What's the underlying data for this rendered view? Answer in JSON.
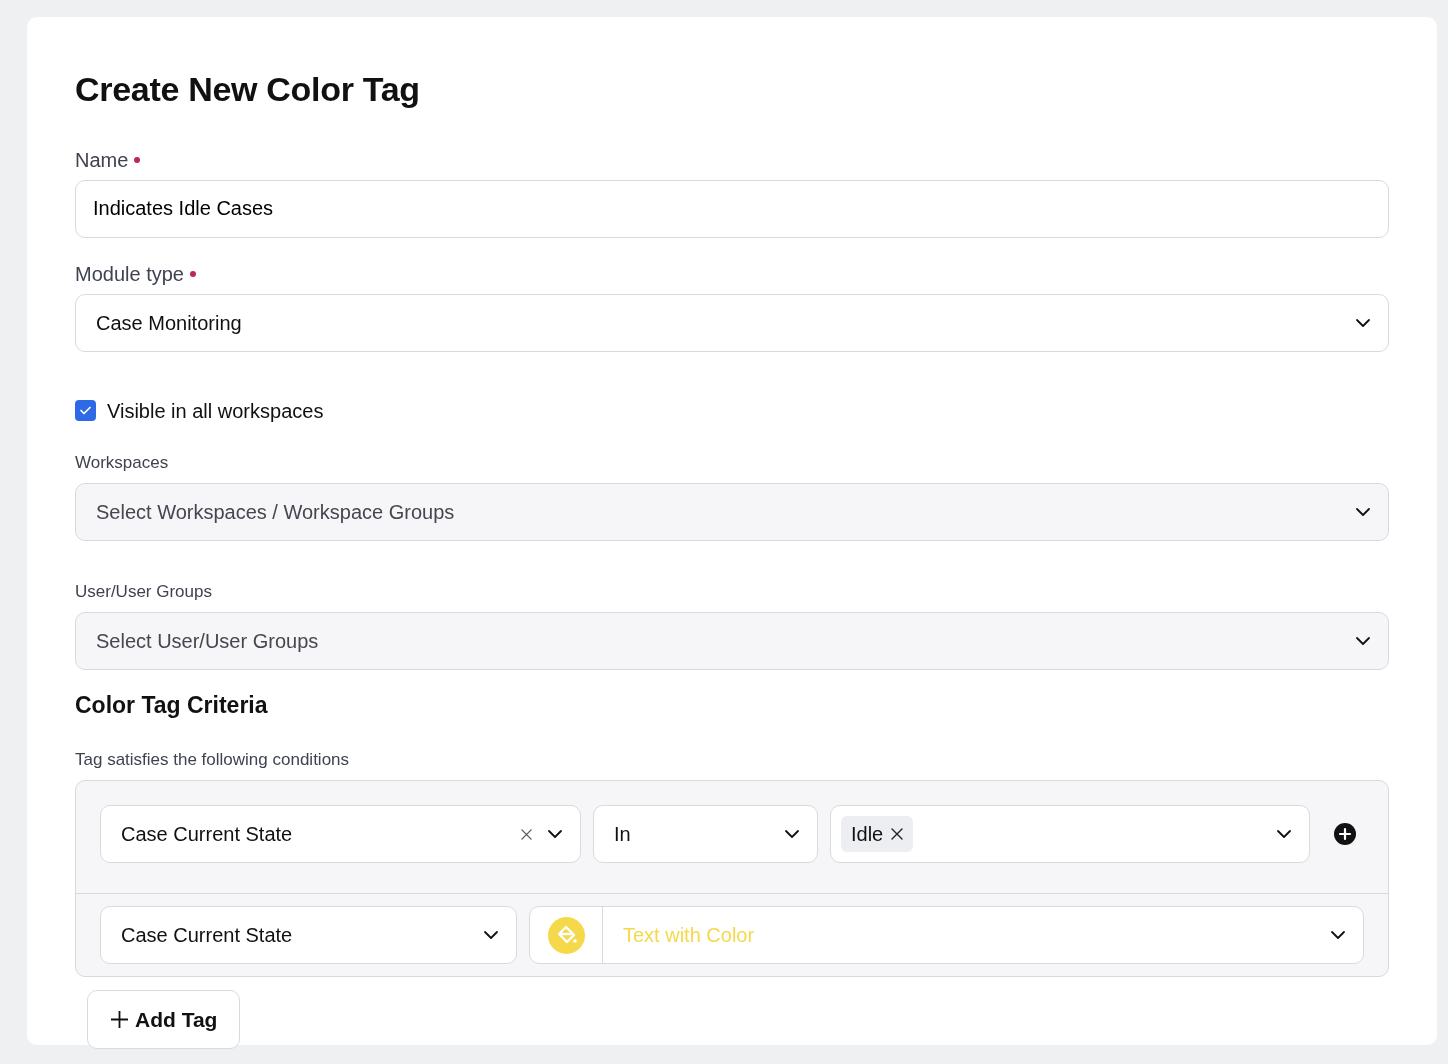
{
  "title": "Create New Color Tag",
  "name_field": {
    "label": "Name",
    "required": true,
    "value": "Indicates Idle Cases"
  },
  "module_type": {
    "label": "Module type",
    "required": true,
    "value": "Case Monitoring"
  },
  "visible_all": {
    "label": "Visible in all workspaces",
    "checked": true
  },
  "workspaces": {
    "label": "Workspaces",
    "placeholder": "Select Workspaces / Workspace Groups"
  },
  "user_groups": {
    "label": "User/User Groups",
    "placeholder": "Select User/User Groups"
  },
  "criteria": {
    "heading": "Color Tag Criteria",
    "subtitle": "Tag satisfies the following conditions",
    "condition": {
      "field": "Case Current State",
      "operator": "In",
      "values": [
        "Idle"
      ]
    },
    "tag": {
      "field": "Case Current State",
      "style": "Text with Color",
      "color": "#f5d94a"
    }
  },
  "add_button": "Add Tag"
}
